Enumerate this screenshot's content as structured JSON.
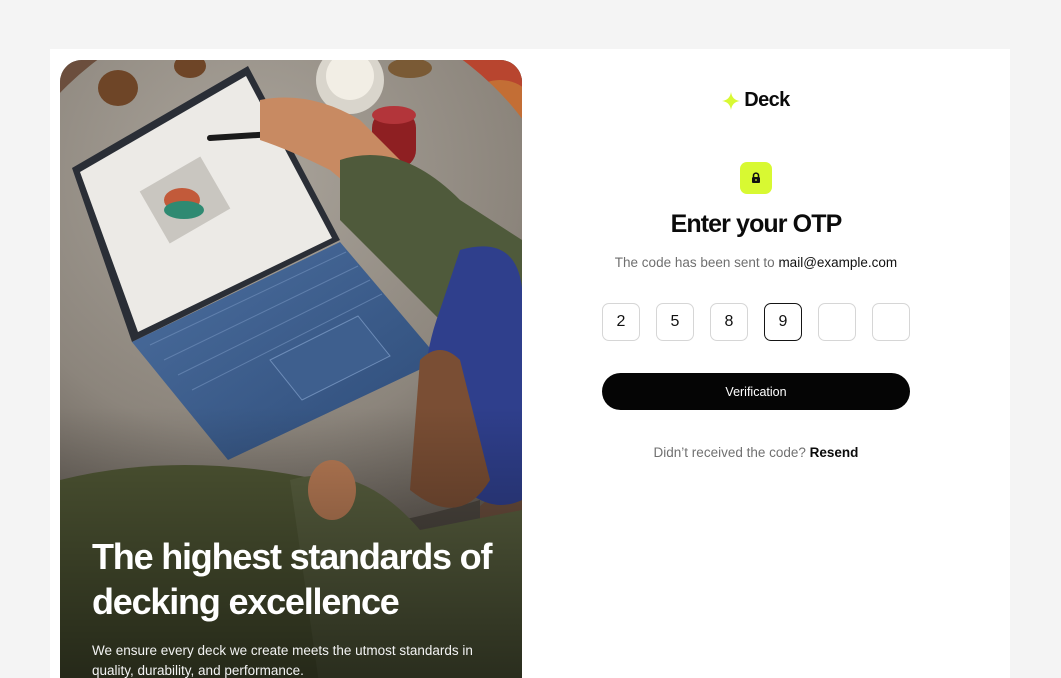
{
  "brand": {
    "name": "Deck",
    "star_color": "#d8f932"
  },
  "hero": {
    "title": "The highest standards of decking excellence",
    "description": "We ensure every deck we create meets the utmost standards in quality, durability, and performance."
  },
  "otp": {
    "title": "Enter your OTP",
    "subtitle_prefix": "The code has been sent to",
    "email": "mail@example.com",
    "digits": [
      "2",
      "5",
      "8",
      "9",
      "",
      ""
    ],
    "active_index": 3
  },
  "verify_button": {
    "label": "Verification"
  },
  "resend": {
    "prompt": "Didn’t received the code?",
    "link_label": "Resend"
  },
  "colors": {
    "accent": "#d8f932",
    "button": "#050505",
    "background": "#f4f4f4"
  },
  "icons": {
    "brand": "sparkle-star-icon",
    "badge": "lock-icon"
  }
}
